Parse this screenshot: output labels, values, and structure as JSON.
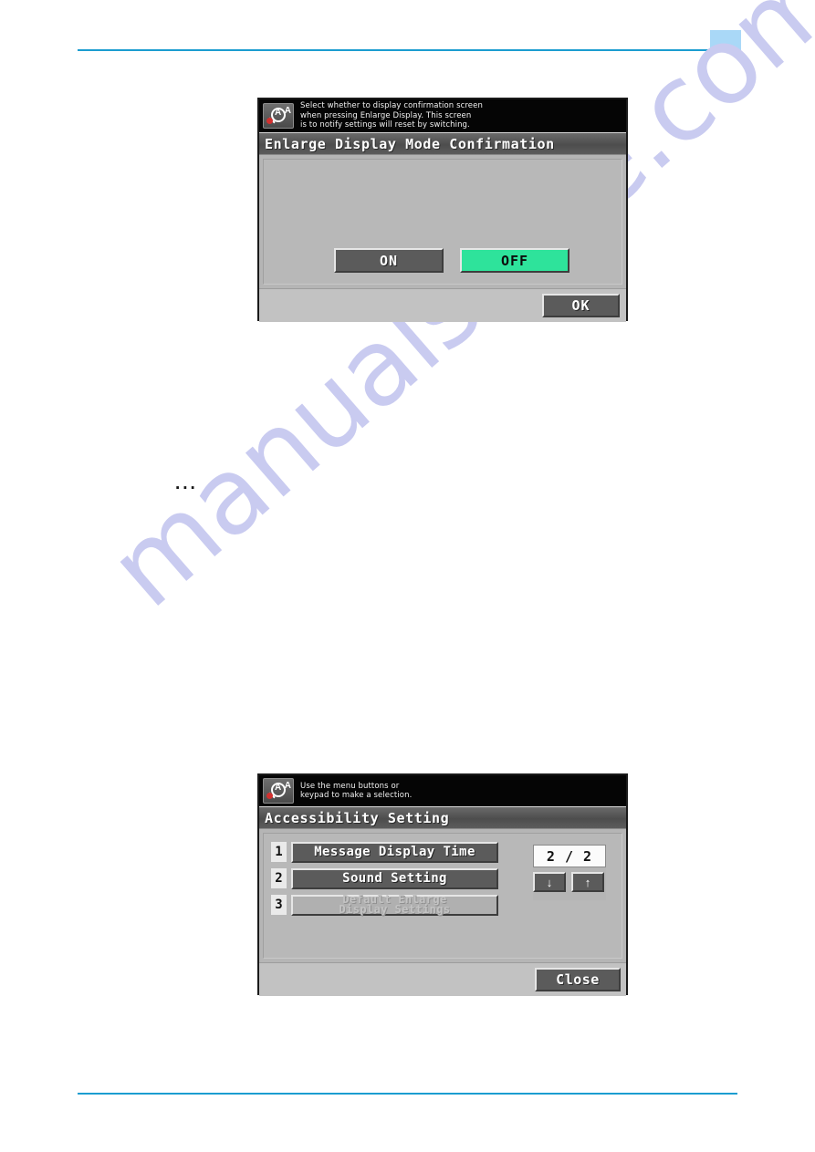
{
  "page": {
    "watermark": "manualshive.com",
    "ellipsis": "...",
    "corner_tab_color": "#a9d8f7",
    "rule_color": "#1b9dd0"
  },
  "panel_enlarge": {
    "icon": "accessibility-magnifier-icon",
    "message": "Select whether to display confirmation screen\nwhen pressing Enlarge Display. This screen\nis to notify settings will reset by switching.",
    "title": "Enlarge Display Mode Confirmation",
    "options": [
      {
        "label": "ON",
        "state": "unselected",
        "color": "#5b5b5b"
      },
      {
        "label": "OFF",
        "state": "selected",
        "color": "#2ee39b"
      }
    ],
    "confirm_label": "OK"
  },
  "panel_accessibility": {
    "icon": "accessibility-magnifier-icon",
    "message": "Use the menu buttons or\nkeypad to make a selection.",
    "title": "Accessibility Setting",
    "menu_items": [
      {
        "number": "1",
        "label": "Message Display Time",
        "enabled": true
      },
      {
        "number": "2",
        "label": "Sound Setting",
        "enabled": true
      },
      {
        "number": "3",
        "label": "Default Enlarge",
        "label2": "Display Settings",
        "enabled": false
      }
    ],
    "paging": {
      "count": "2 / 2",
      "down_label": "↓",
      "up_label": "↑"
    },
    "close_label": "Close"
  }
}
